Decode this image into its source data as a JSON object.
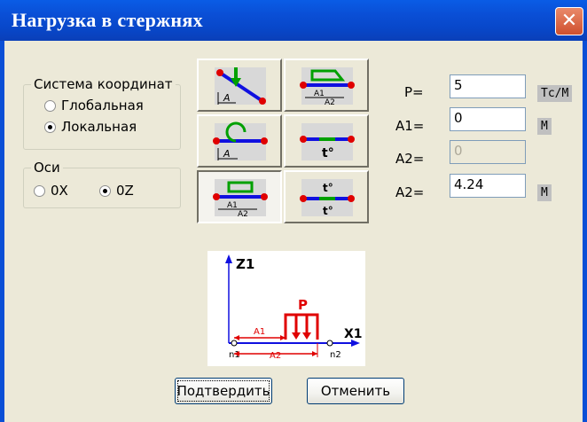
{
  "window": {
    "title": "Нагрузка в стержнях",
    "close_glyph": "✕"
  },
  "coord_system": {
    "legend": "Система координат",
    "options": [
      {
        "label": "Глобальная",
        "selected": false
      },
      {
        "label": "Локальная",
        "selected": true
      }
    ]
  },
  "axes": {
    "legend": "Оси",
    "options": [
      {
        "label": "0X",
        "selected": false
      },
      {
        "label": "0Z",
        "selected": true
      }
    ]
  },
  "load_types": [
    {
      "icon": "point-force-inclined-icon",
      "selected": false
    },
    {
      "icon": "trapezoid-distributed-load-icon",
      "selected": false
    },
    {
      "icon": "point-moment-icon",
      "selected": false
    },
    {
      "icon": "uniform-temperature-icon",
      "selected": false
    },
    {
      "icon": "partial-distributed-load-icon",
      "selected": true
    },
    {
      "icon": "temperature-gradient-icon",
      "selected": false
    }
  ],
  "params": [
    {
      "label": "P=",
      "value": "5",
      "unit": "Тс/М",
      "enabled": true
    },
    {
      "label": "A1=",
      "value": "0",
      "unit": "М",
      "enabled": true
    },
    {
      "label": "A2=",
      "value": "0",
      "unit": "",
      "enabled": false
    },
    {
      "label": "A2=",
      "value": "4.24",
      "unit": "М",
      "enabled": true
    }
  ],
  "preview": {
    "axis_z": "Z1",
    "axis_x": "X1",
    "load": "P",
    "dim_a1": "A1",
    "dim_a2": "A2",
    "node1": "n1",
    "node2": "n2"
  },
  "buttons": {
    "confirm": "Подтвердить",
    "cancel": "Отменить"
  },
  "colors": {
    "accent_red": "#E00000",
    "accent_blue": "#1010E0",
    "titlebar": "#0A4FD6"
  }
}
